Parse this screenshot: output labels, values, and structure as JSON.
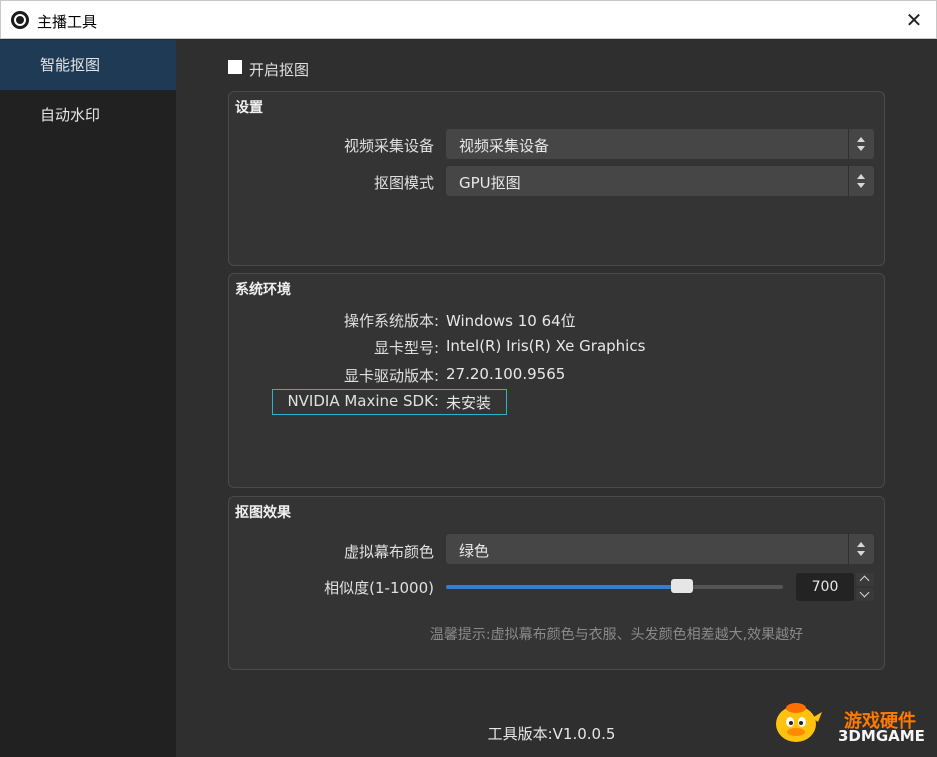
{
  "window": {
    "title": "主播工具",
    "close_glyph": "✕"
  },
  "sidebar": {
    "items": [
      {
        "label": "智能抠图",
        "active": true
      },
      {
        "label": "自动水印",
        "active": false
      }
    ]
  },
  "main": {
    "enable_checkbox": {
      "label": "开启抠图",
      "checked": false
    },
    "settings_group": {
      "title": "设置",
      "rows": [
        {
          "label": "视频采集设备",
          "value": "视频采集设备"
        },
        {
          "label": "抠图模式",
          "value": "GPU抠图"
        }
      ]
    },
    "system_group": {
      "title": "系统环境",
      "rows": [
        {
          "label": "操作系统版本:",
          "value": "Windows 10 64位"
        },
        {
          "label": "显卡型号:",
          "value": "Intel(R) Iris(R) Xe Graphics"
        },
        {
          "label": "显卡驱动版本:",
          "value": "27.20.100.9565"
        },
        {
          "label": "NVIDIA Maxine SDK:",
          "value": "未安装"
        }
      ]
    },
    "effect_group": {
      "title": "抠图效果",
      "background_color": {
        "label": "虚拟幕布颜色",
        "value": "绿色"
      },
      "similarity": {
        "label": "相似度(1-1000)",
        "value": "700",
        "min": 1,
        "max": 1000,
        "fraction": 0.7
      },
      "hint": "温馨提示:虚拟幕布颜色与衣服、头发颜色相差越大,效果越好"
    },
    "version": "工具版本:V1.0.0.5"
  },
  "watermark": {
    "line1": "游戏硬件",
    "line2": "3DMGAME"
  },
  "colors": {
    "sidebar_active": "#1f3a55",
    "slider_fill": "#2f7ed8",
    "highlight_border": "#2bb5c4",
    "watermark_orange": "#ff7a00"
  }
}
